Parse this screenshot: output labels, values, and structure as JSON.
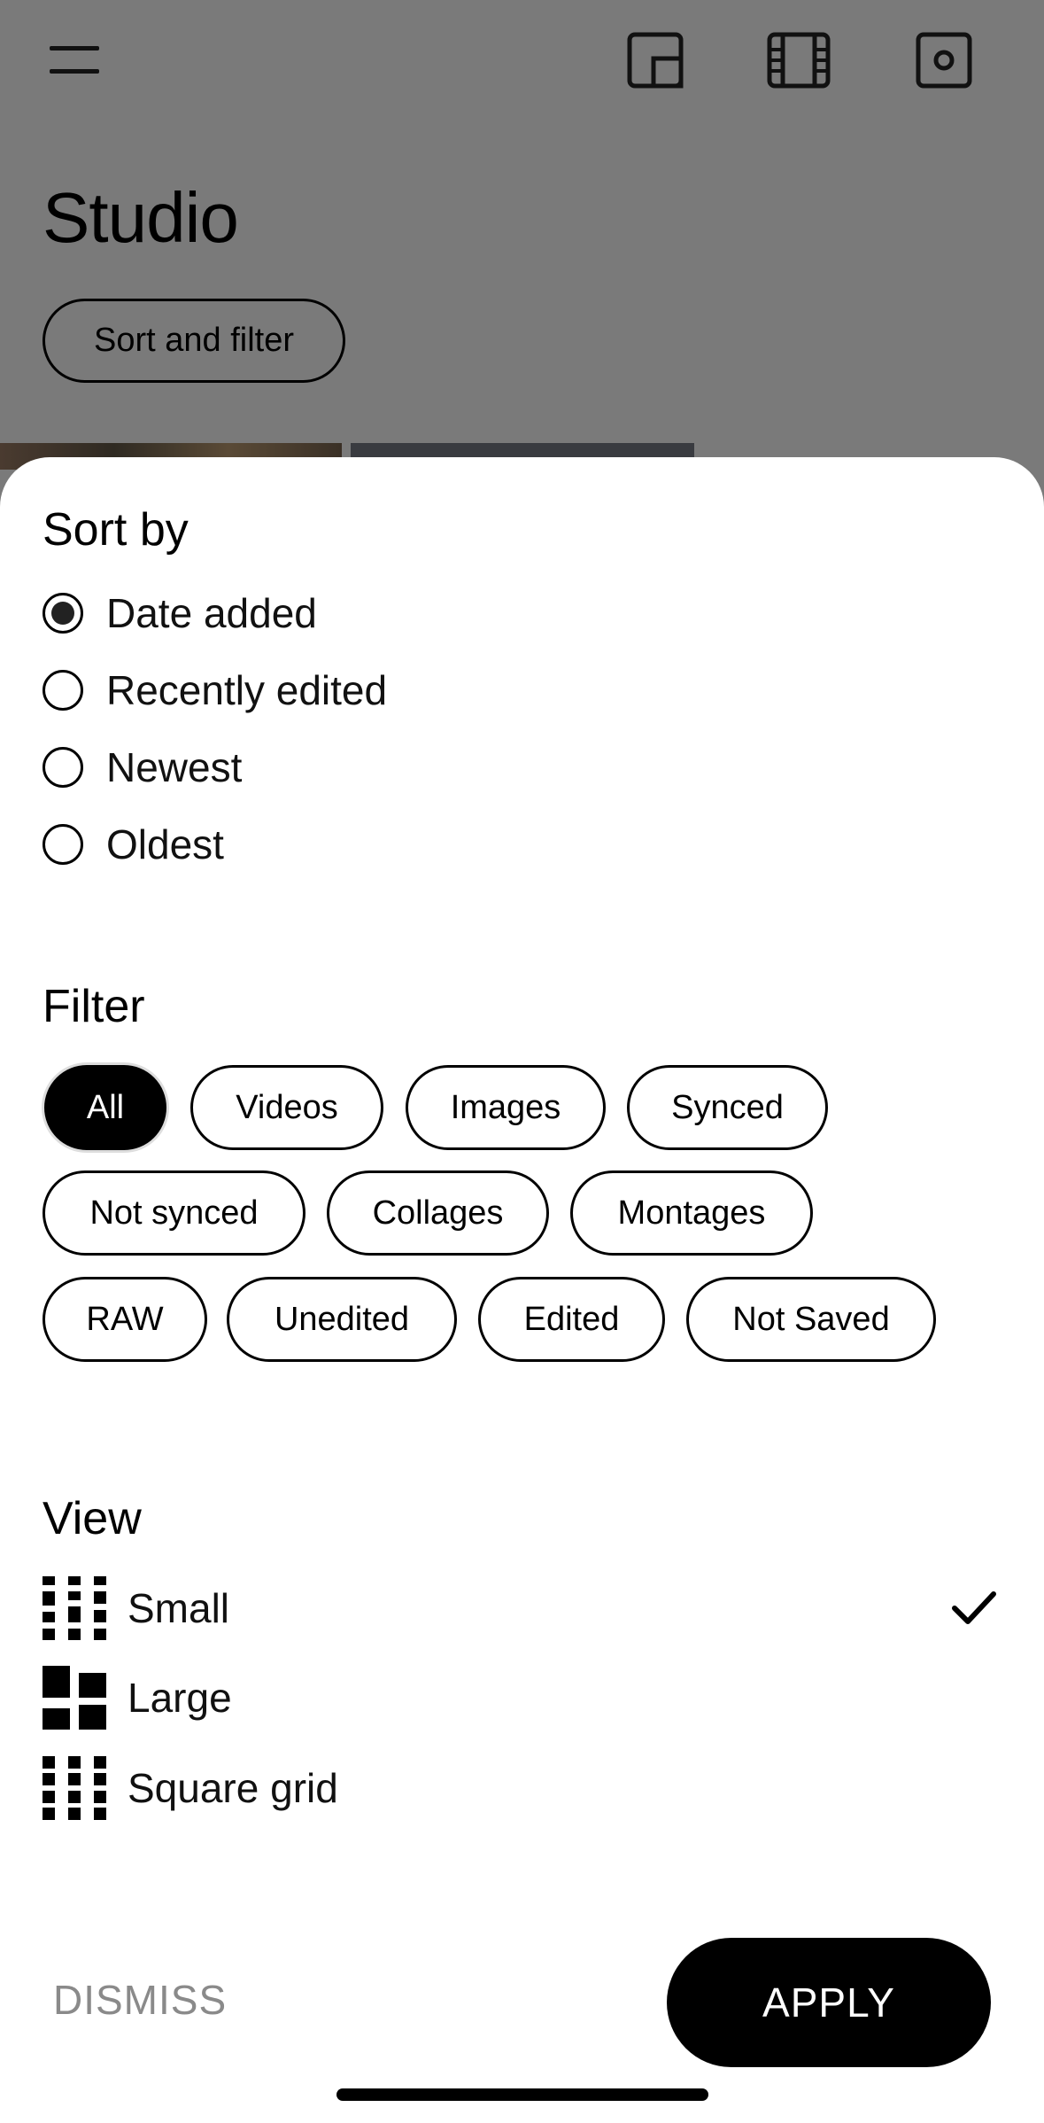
{
  "header": {
    "title": "Studio",
    "sort_filter_label": "Sort and filter",
    "icons": [
      "menu-icon",
      "picture-in-picture-icon",
      "film-icon",
      "camera-icon"
    ]
  },
  "sheet": {
    "sort": {
      "title": "Sort by",
      "options": [
        {
          "label": "Date added",
          "selected": true
        },
        {
          "label": "Recently edited",
          "selected": false
        },
        {
          "label": "Newest",
          "selected": false
        },
        {
          "label": "Oldest",
          "selected": false
        }
      ]
    },
    "filter": {
      "title": "Filter",
      "chips": [
        {
          "label": "All",
          "selected": true
        },
        {
          "label": "Videos",
          "selected": false
        },
        {
          "label": "Images",
          "selected": false
        },
        {
          "label": "Synced",
          "selected": false
        },
        {
          "label": "Not synced",
          "selected": false
        },
        {
          "label": "Collages",
          "selected": false
        },
        {
          "label": "Montages",
          "selected": false
        },
        {
          "label": "RAW",
          "selected": false
        },
        {
          "label": "Unedited",
          "selected": false
        },
        {
          "label": "Edited",
          "selected": false
        },
        {
          "label": "Not Saved",
          "selected": false
        }
      ]
    },
    "view": {
      "title": "View",
      "options": [
        {
          "label": "Small",
          "icon": "small-grid-icon",
          "selected": true
        },
        {
          "label": "Large",
          "icon": "large-grid-icon",
          "selected": false
        },
        {
          "label": "Square grid",
          "icon": "square-grid-icon",
          "selected": false
        }
      ]
    },
    "actions": {
      "dismiss": "DISMISS",
      "apply": "APPLY"
    }
  },
  "colors": {
    "overlay": "#7a7a7a",
    "sheet": "#ffffff",
    "accent": "#000000",
    "muted_text": "#8a8a8a"
  }
}
